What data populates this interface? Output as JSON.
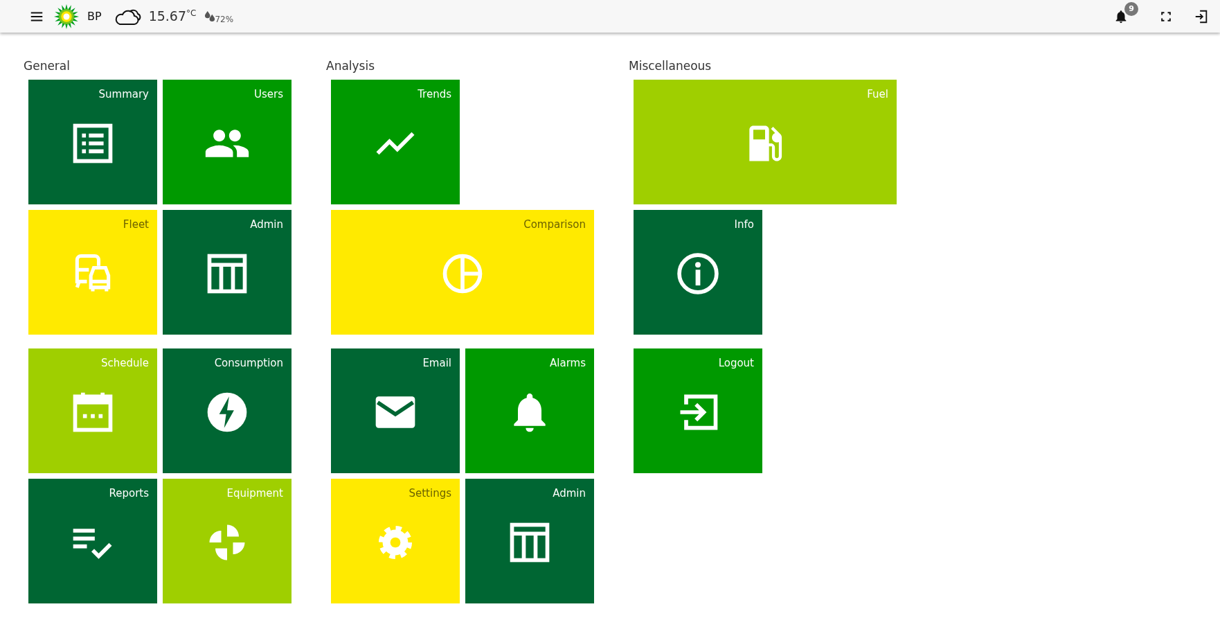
{
  "topbar": {
    "brand": "BP",
    "temperature": "15.67$^{°C}$",
    "humidity": "72%",
    "notifications": "9"
  },
  "sections": [
    {
      "title": "General",
      "blocks": [
        [
          {
            "label": "Summary",
            "kind": "list",
            "color": "#006633",
            "wide": false
          },
          {
            "label": "Users",
            "kind": "people",
            "color": "#009900",
            "wide": false
          },
          {
            "label": "Fleet",
            "kind": "vehicles",
            "color": "#ffea00",
            "wide": false
          },
          {
            "label": "Admin",
            "kind": "table",
            "color": "#006633",
            "wide": false
          }
        ],
        [
          {
            "label": "Schedule",
            "kind": "calendar",
            "color": "#9fcf00",
            "wide": false
          },
          {
            "label": "Consumption",
            "kind": "bolt",
            "color": "#006633",
            "wide": false
          },
          {
            "label": "Reports",
            "kind": "checklist",
            "color": "#006633",
            "wide": false
          },
          {
            "label": "Equipment",
            "kind": "fan",
            "color": "#9fcf00",
            "wide": false
          }
        ]
      ]
    },
    {
      "title": "Analysis",
      "blocks": [
        [
          {
            "label": "Trends",
            "kind": "trend",
            "color": "#009900",
            "wide": false
          },
          {
            "label": "Comparison",
            "kind": "pie",
            "color": "#ffea00",
            "wide": true
          }
        ],
        [
          {
            "label": "Email",
            "kind": "mail",
            "color": "#006633",
            "wide": false
          },
          {
            "label": "Alarms",
            "kind": "bell",
            "color": "#009900",
            "wide": false
          },
          {
            "label": "Settings",
            "kind": "gear",
            "color": "#ffea00",
            "wide": false
          },
          {
            "label": "Admin",
            "kind": "table",
            "color": "#006633",
            "wide": false
          }
        ]
      ]
    },
    {
      "title": "Miscellaneous",
      "blocks": [
        [
          {
            "label": "Fuel",
            "kind": "pump",
            "color": "#9fcf00",
            "wide": true
          },
          {
            "label": "Info",
            "kind": "info",
            "color": "#006633",
            "wide": false
          }
        ],
        [
          {
            "label": "Logout",
            "kind": "login",
            "color": "#009900",
            "wide": false
          }
        ]
      ]
    }
  ]
}
